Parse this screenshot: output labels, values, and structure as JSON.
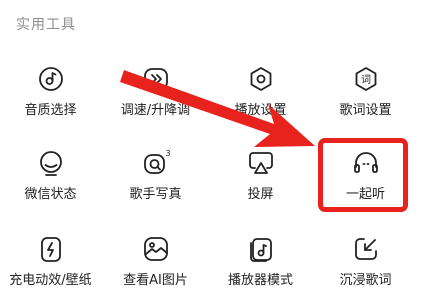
{
  "section": {
    "title": "实用工具"
  },
  "tools": [
    {
      "label": "音质选择",
      "icon": "sound-quality-icon"
    },
    {
      "label": "调速/升降调",
      "icon": "speed-pitch-icon"
    },
    {
      "label": "播放设置",
      "icon": "play-settings-icon"
    },
    {
      "label": "歌词设置",
      "icon": "lyrics-settings-icon"
    },
    {
      "label": "微信状态",
      "icon": "wechat-status-icon"
    },
    {
      "label": "歌手写真",
      "icon": "singer-photo-icon",
      "badge": "3"
    },
    {
      "label": "投屏",
      "icon": "screen-cast-icon"
    },
    {
      "label": "一起听",
      "icon": "listen-together-icon"
    },
    {
      "label": "充电动效/壁纸",
      "icon": "charging-wallpaper-icon"
    },
    {
      "label": "查看AI图片",
      "icon": "ai-picture-icon"
    },
    {
      "label": "播放器模式",
      "icon": "player-mode-icon"
    },
    {
      "label": "沉浸歌词",
      "icon": "immersive-lyrics-icon"
    }
  ],
  "annotation": {
    "highlight_color": "#e8231e",
    "highlighted_item": "一起听"
  }
}
